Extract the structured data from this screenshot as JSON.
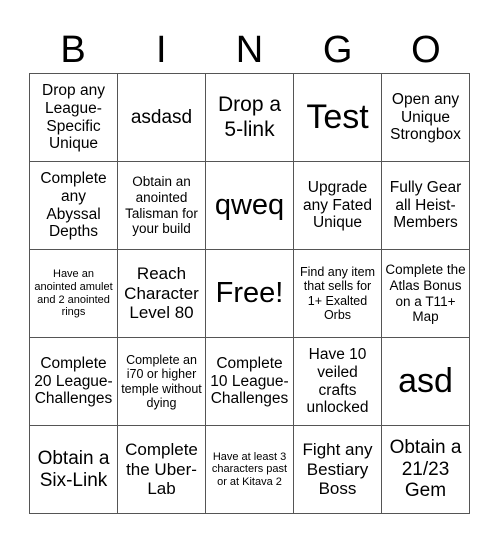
{
  "header": [
    "B",
    "I",
    "N",
    "G",
    "O"
  ],
  "cells": [
    {
      "text": "Drop any League-Specific Unique",
      "size": "s15"
    },
    {
      "text": "asdasd",
      "size": "s19"
    },
    {
      "text": "Drop a 5-link",
      "size": "s22"
    },
    {
      "text": "Test",
      "size": "s34"
    },
    {
      "text": "Open any Unique Strongbox",
      "size": "s15"
    },
    {
      "text": "Complete any Abyssal Depths",
      "size": "s15"
    },
    {
      "text": "Obtain an anointed Talisman for your build",
      "size": "s13"
    },
    {
      "text": "qweq",
      "size": "s30"
    },
    {
      "text": "Upgrade any Fated Unique",
      "size": "s15"
    },
    {
      "text": "Fully Gear all Heist-Members",
      "size": "s15"
    },
    {
      "text": "Have an anointed amulet and 2 anointed rings",
      "size": "s11"
    },
    {
      "text": "Reach Character Level 80",
      "size": "s17"
    },
    {
      "text": "Free!",
      "size": "s30"
    },
    {
      "text": "Find any item that sells for 1+ Exalted Orbs",
      "size": "s12"
    },
    {
      "text": "Complete the Atlas Bonus on a T11+ Map",
      "size": "s13"
    },
    {
      "text": "Complete 20 League-Challenges",
      "size": "s15"
    },
    {
      "text": "Complete an i70 or higher temple without dying",
      "size": "s12"
    },
    {
      "text": "Complete 10 League-Challenges",
      "size": "s15"
    },
    {
      "text": "Have 10 veiled crafts unlocked",
      "size": "s15"
    },
    {
      "text": "asd",
      "size": "s34"
    },
    {
      "text": "Obtain a Six-Link",
      "size": "s19"
    },
    {
      "text": "Complete the Uber-Lab",
      "size": "s17"
    },
    {
      "text": "Have at least 3 characters past or at Kitava 2",
      "size": "s11"
    },
    {
      "text": "Fight any Bestiary Boss",
      "size": "s17"
    },
    {
      "text": "Obtain a 21/23 Gem",
      "size": "s19"
    }
  ]
}
